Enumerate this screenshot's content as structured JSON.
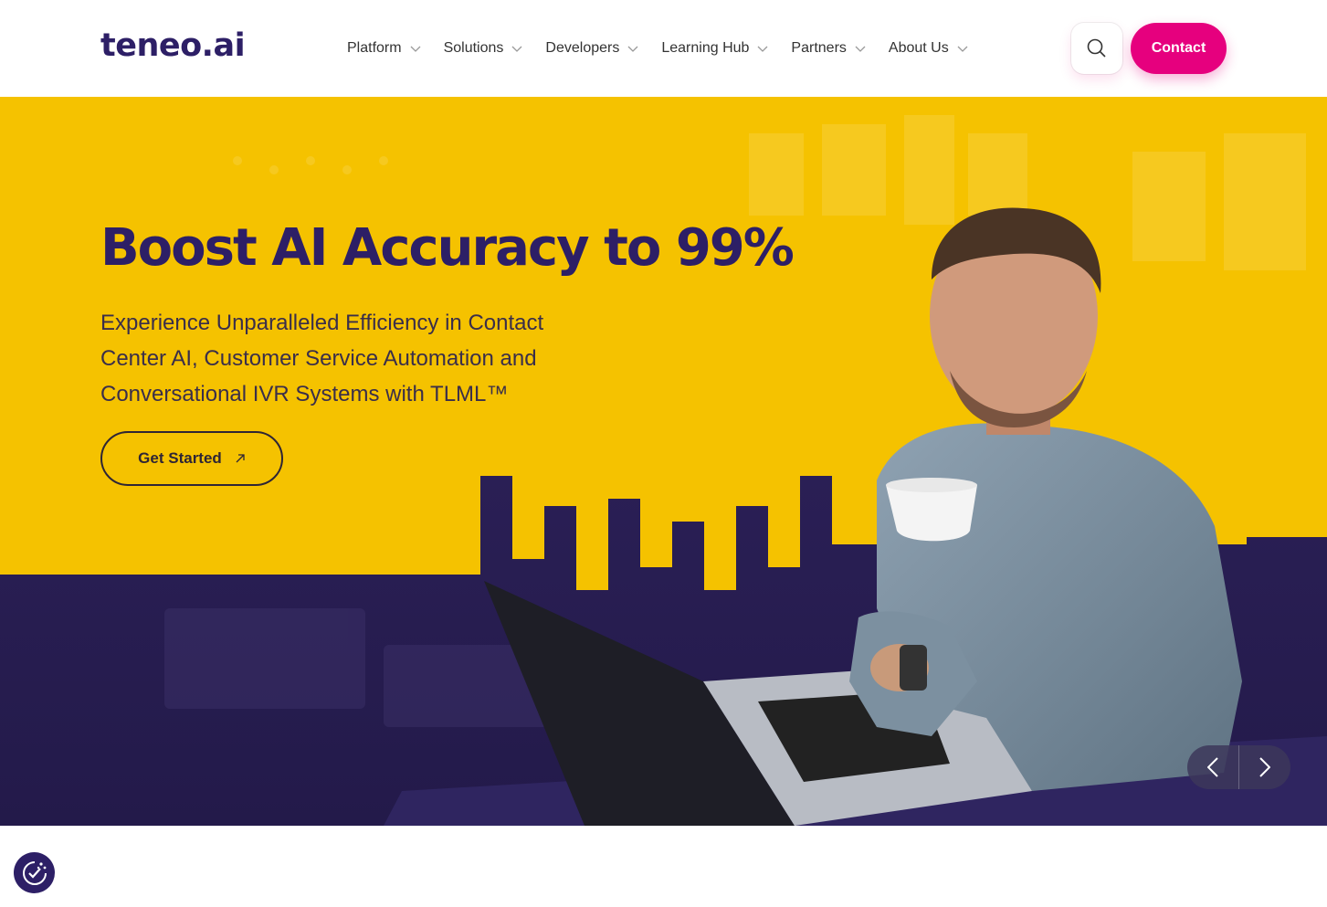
{
  "header": {
    "logo": "teneo.ai",
    "nav": [
      {
        "label": "Platform"
      },
      {
        "label": "Solutions"
      },
      {
        "label": "Developers"
      },
      {
        "label": "Learning Hub"
      },
      {
        "label": "Partners"
      },
      {
        "label": "About Us"
      }
    ],
    "contact_label": "Contact"
  },
  "hero": {
    "headline": "Boost AI Accuracy to 99%",
    "subheadline": "Experience Unparalleled Efficiency in Contact Center AI, Customer Service Automation and Conversational IVR Systems with TLML™",
    "cta_label": "Get Started"
  },
  "colors": {
    "brand_purple": "#2d1f66",
    "accent_pink": "#e6007e",
    "hero_yellow": "#f5c200"
  }
}
